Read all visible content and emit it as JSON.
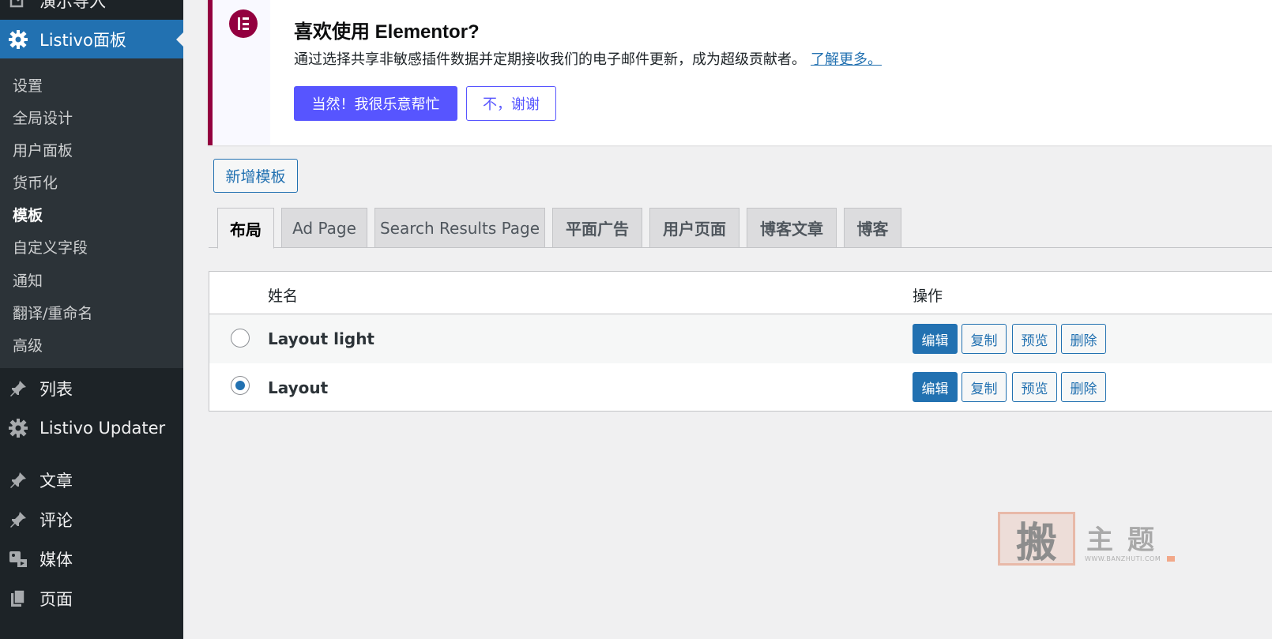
{
  "sidebar": {
    "top_partial": "演示导入",
    "current_menu": "Listivo面板",
    "submenu": [
      "设置",
      "全局设计",
      "用户面板",
      "货币化",
      "模板",
      "自定义字段",
      "通知",
      "翻译/重命名",
      "高级"
    ],
    "active_submenu": "模板",
    "menu_items": [
      {
        "label": "列表",
        "icon": "pin-icon"
      },
      {
        "label": "Listivo Updater",
        "icon": "gear-icon"
      },
      {
        "label": "文章",
        "icon": "pin-icon"
      },
      {
        "label": "评论",
        "icon": "pin-icon"
      },
      {
        "label": "媒体",
        "icon": "media-icon"
      },
      {
        "label": "页面",
        "icon": "page-icon"
      }
    ]
  },
  "notice": {
    "title": "喜欢使用 Elementor?",
    "description": "通过选择共享非敏感插件数据并定期接收我们的电子邮件更新，成为超级贡献者。",
    "learn_more": "了解更多。",
    "accept_label": "当然！我很乐意帮忙",
    "decline_label": "不，谢谢",
    "brand_color": "#93003f",
    "button_color": "#5755ff"
  },
  "add_template_label": "新增模板",
  "tabs": [
    "布局",
    "Ad Page",
    "Search Results Page",
    "平面广告",
    "用户页面",
    "博客文章",
    "博客"
  ],
  "active_tab": "布局",
  "table": {
    "columns": [
      "姓名",
      "操作"
    ],
    "rows": [
      {
        "name": "Layout light",
        "selected": false
      },
      {
        "name": "Layout",
        "selected": true
      }
    ],
    "actions": [
      "编辑",
      "复制",
      "预览",
      "删除"
    ]
  },
  "watermark": {
    "seal_char": "搬",
    "text": "主题",
    "url": "WWW.BANZHUTI.COM"
  },
  "colors": {
    "sidebar_bg": "#1d2327",
    "submenu_bg": "#2c3338",
    "accent": "#2271b1",
    "page_bg": "#f0f0f1"
  }
}
